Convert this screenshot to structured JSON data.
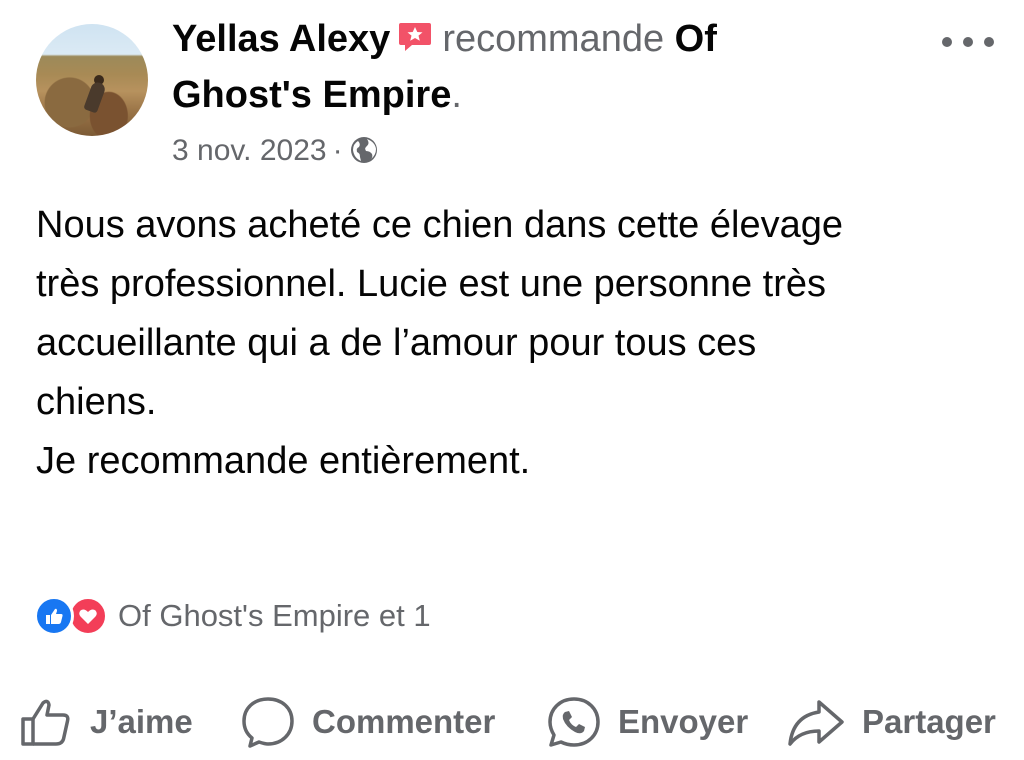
{
  "post": {
    "author": "Yellas Alexy",
    "action_word": "recommande",
    "page_name_part1": "Of",
    "page_name_part2": "Ghost's Empire",
    "period": ".",
    "date": "3 nov. 2023",
    "separator": "·",
    "audience_icon": "globe-icon",
    "text": "Nous avons acheté ce chien dans cette élevage\ntrès professionnel. Lucie est une personne très\naccueillante qui a de l’amour pour tous ces\nchiens.\nJe recommande entièrement.",
    "reactions_text": "Of Ghost's Empire et 1"
  },
  "actions": {
    "like": "J’aime",
    "comment": "Commenter",
    "send": "Envoyer",
    "share": "Partager"
  },
  "colors": {
    "text": "#050505",
    "secondary": "#65676b",
    "like_blue": "#1877f2",
    "love_red": "#f33e58",
    "recommend_badge": "#f25268"
  }
}
